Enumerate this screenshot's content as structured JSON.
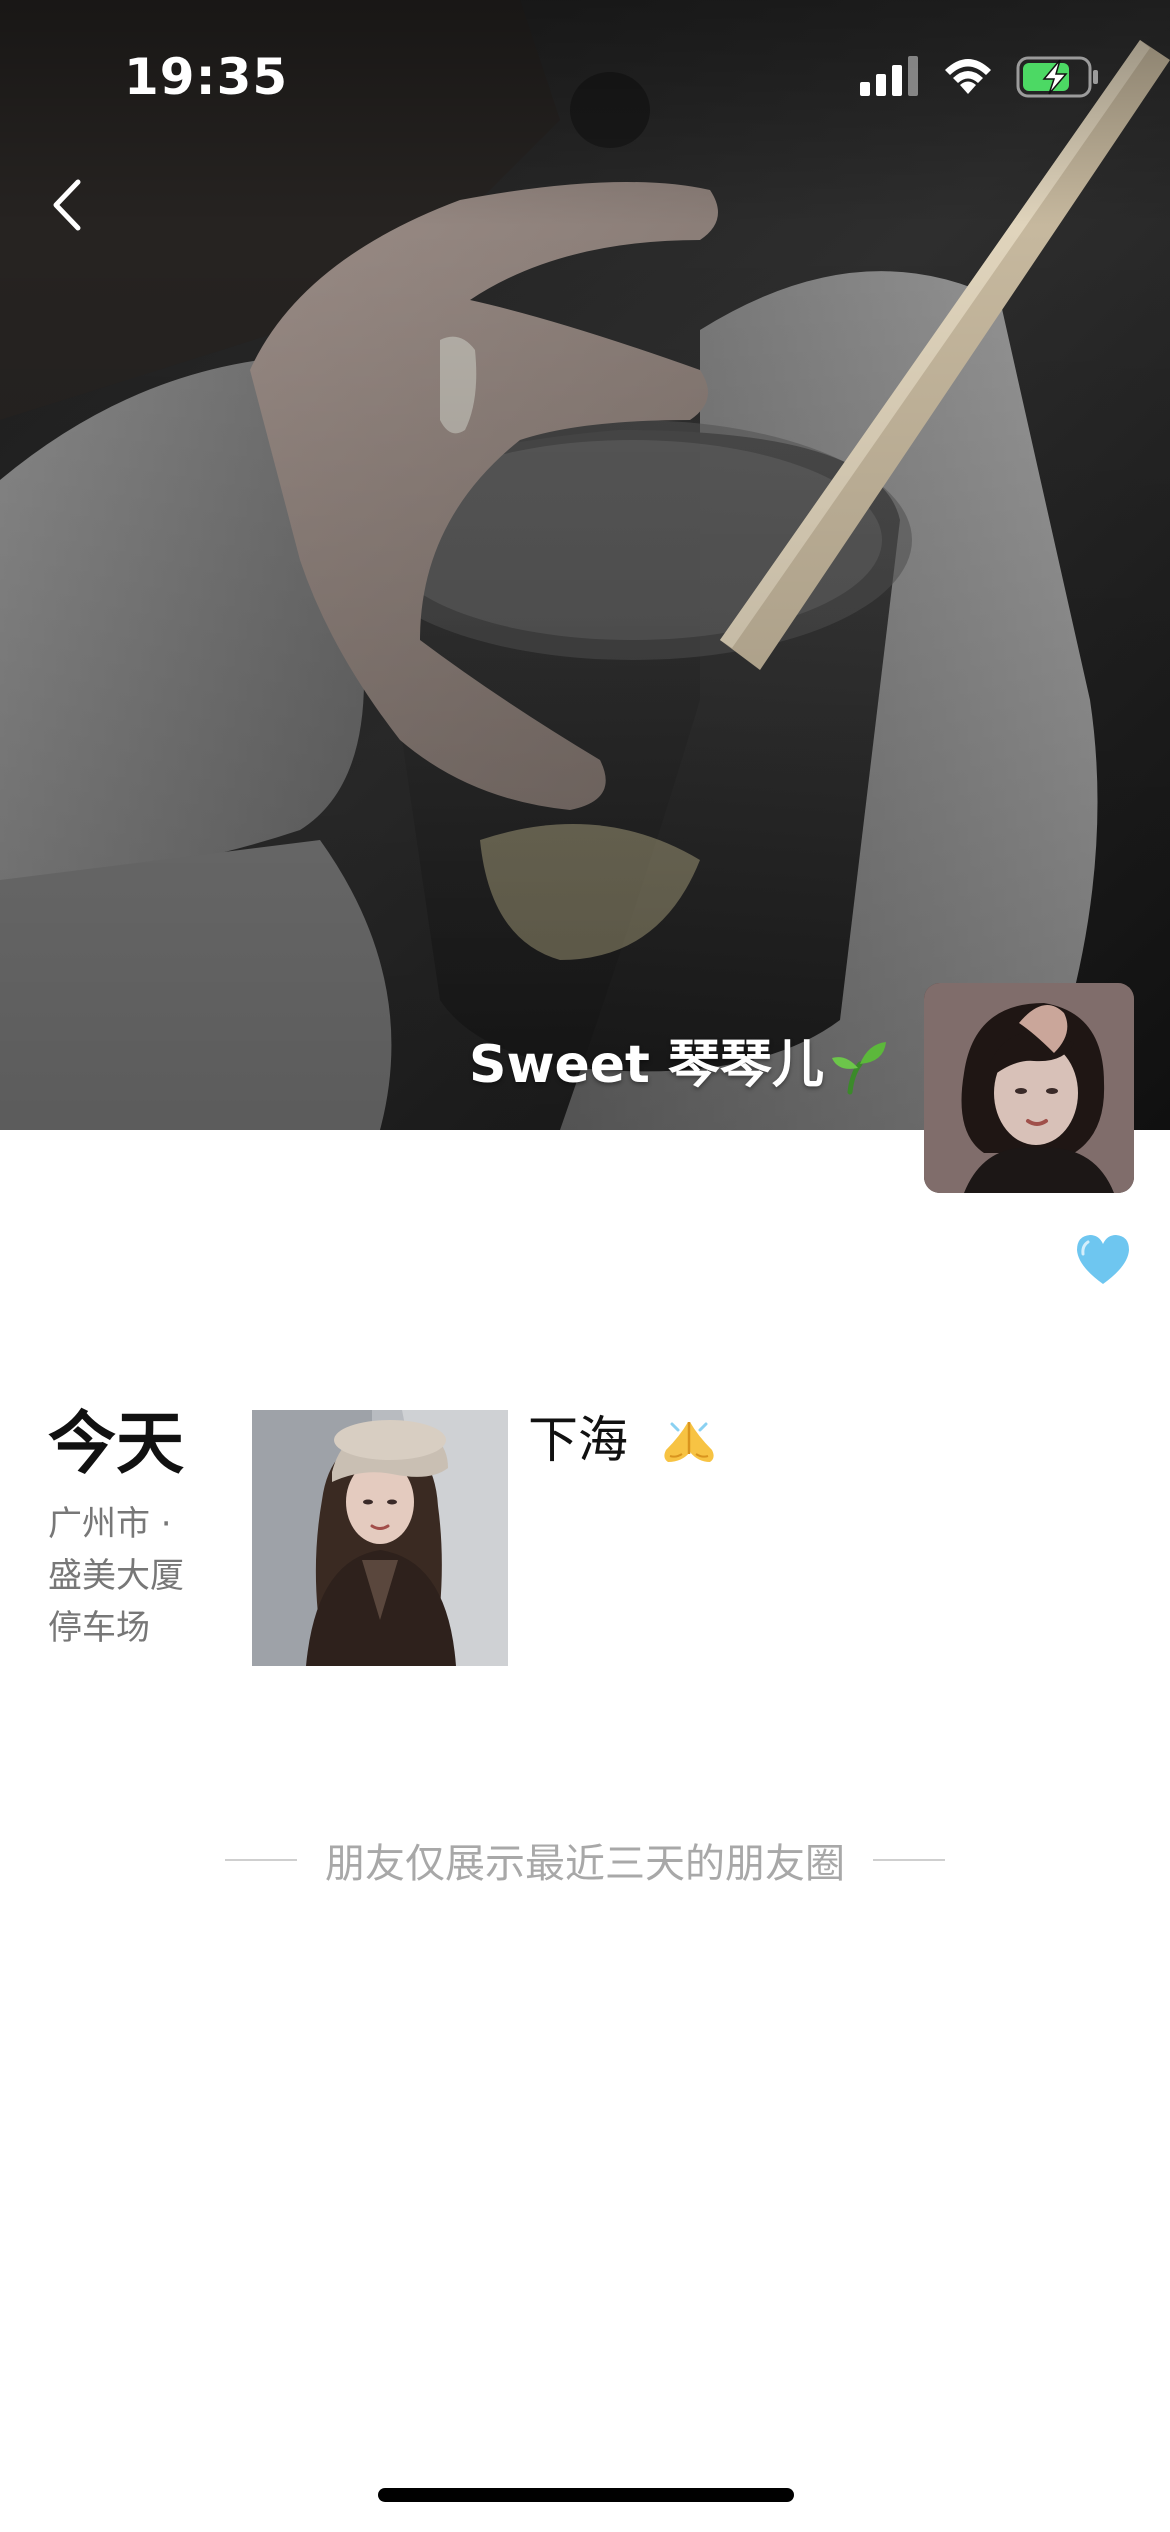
{
  "status_bar": {
    "time": "19:35",
    "icons": [
      "signal-icon",
      "wifi-icon",
      "battery-charging-icon"
    ],
    "battery_color": "#4cd964"
  },
  "navigation": {
    "back_icon": "chevron-left-icon"
  },
  "profile": {
    "name": "Sweet 琴琴儿",
    "name_emoji": "sprout-icon",
    "status_emoji": "blue-heart-icon"
  },
  "posts": [
    {
      "day": "今天",
      "location_lines": [
        "广州市 ·",
        "盛美大厦",
        "停车场"
      ],
      "text": "下海",
      "emoji": "folded-hands-icon"
    }
  ],
  "footer": {
    "notice": "朋友仅展示最近三天的朋友圈"
  },
  "colors": {
    "heart": "#6ec6f0",
    "secondary_text": "#777777",
    "notice_text": "#a8a8a8"
  }
}
